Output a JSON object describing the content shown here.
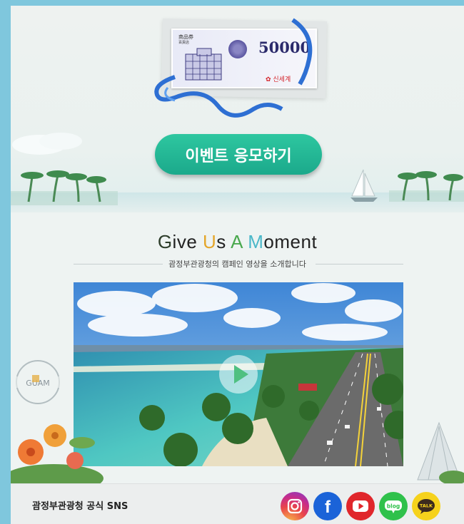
{
  "gift_card": {
    "label_line1": "商品券",
    "label_line2": "百貨店",
    "amount": "50000",
    "brand": "✿ 신세계"
  },
  "event_button_label": "이벤트 응모하기",
  "moment": {
    "title_parts": [
      "G",
      "ive ",
      "U",
      "s ",
      "A",
      " ",
      "M",
      "oment"
    ],
    "subtitle": "괌정부관광청의 캠페인 영상을 소개합니다"
  },
  "stamp_text": "GUAM",
  "footer": {
    "title": "괌정부관광청 공식 SNS",
    "sns": [
      {
        "name": "instagram",
        "color": "#d6336c",
        "label": ""
      },
      {
        "name": "facebook",
        "color": "#1b63d8",
        "label": "f"
      },
      {
        "name": "youtube",
        "color": "#e0262b",
        "label": ""
      },
      {
        "name": "blog",
        "color": "#2fc14b",
        "label": "blog"
      },
      {
        "name": "kakaotalk",
        "color": "#f6d21c",
        "label": "TALK"
      }
    ]
  },
  "colors": {
    "accent_green": "#1fb08f",
    "page_border": "#7fc7dd"
  }
}
